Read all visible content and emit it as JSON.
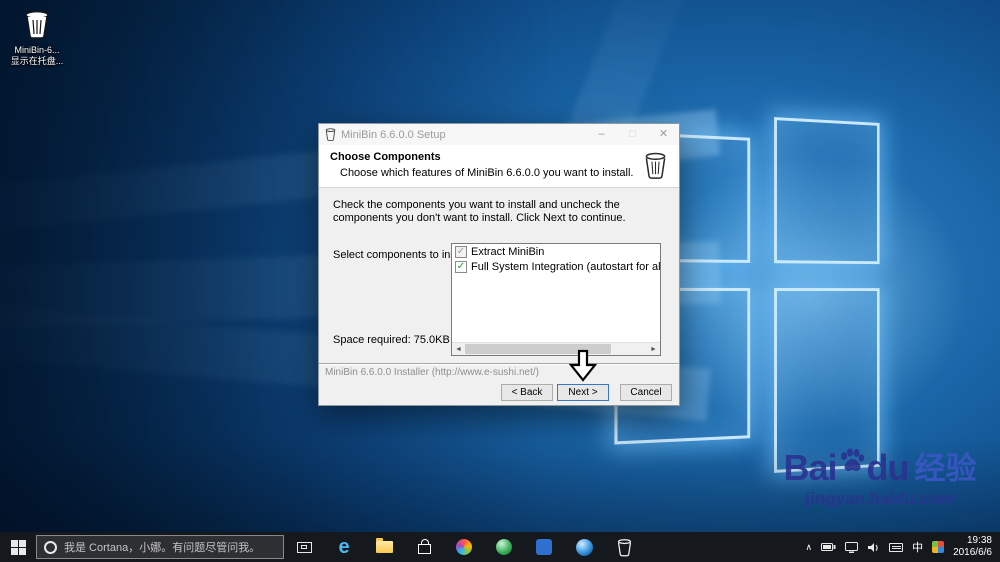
{
  "desktop": {
    "icon_label": "MiniBin-6...",
    "icon_sublabel": "显示在托盘..."
  },
  "installer": {
    "title": "MiniBin 6.6.0.0 Setup",
    "window_controls": {
      "minimize": "–",
      "maximize": "□",
      "close": "✕"
    },
    "header": {
      "title": "Choose Components",
      "subtitle": "Choose which features of MiniBin 6.6.0.0 you want to install."
    },
    "description": "Check the components you want to install and uncheck the components you don't want to install. Click Next to continue.",
    "components_label": "Select components to install:",
    "components": [
      {
        "label": "Extract MiniBin",
        "checked": true,
        "check_style": "gray"
      },
      {
        "label": "Full System Integration (autostart for all users, uninstall",
        "checked": true,
        "check_style": "green"
      }
    ],
    "space_required": "Space required: 75.0KB",
    "branding": "MiniBin 6.6.0.0 Installer (http://www.e-sushi.net/)",
    "buttons": {
      "back": "< Back",
      "next": "Next >",
      "cancel": "Cancel"
    },
    "colors": {
      "check_green": "#1e9e2c",
      "dialog_bg": "#f0f0f0"
    }
  },
  "icons": {
    "check": "✓",
    "scroll_left": "◄",
    "scroll_right": "►",
    "chevron_up": "∧",
    "edge": "e"
  },
  "watermark": {
    "bai": "Bai",
    "du": "du",
    "suffix": "经验",
    "url": "jingyan.baidu.com",
    "color": "#2a3390"
  },
  "taskbar": {
    "search_text": "我是 Cortana，小娜。有问题尽管问我。",
    "tray": {
      "lang": "中",
      "time": "19:38",
      "date": "2016/6/6"
    }
  }
}
